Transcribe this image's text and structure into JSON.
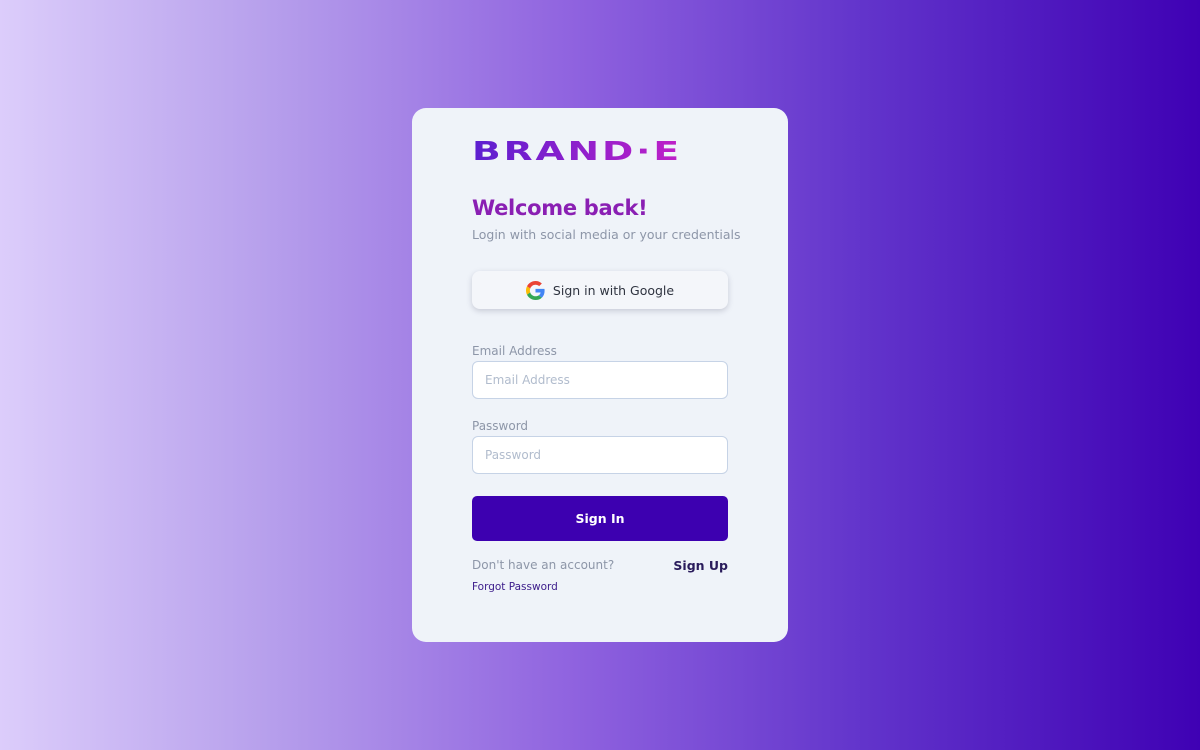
{
  "brand": {
    "name": "BRAND·E",
    "gradient_start": "#5b1fd0",
    "gradient_end": "#c020c8"
  },
  "login": {
    "title": "Welcome back!",
    "subtitle": "Login with social media or your credentials",
    "google_button_label": "Sign in with Google",
    "google_icon": "google-icon",
    "email": {
      "label": "Email Address",
      "placeholder": "Email Address",
      "value": ""
    },
    "password": {
      "label": "Password",
      "placeholder": "Password",
      "value": ""
    },
    "submit_label": "Sign In",
    "no_account_text": "Don't have an account?",
    "signup_label": "Sign Up",
    "forgot_label": "Forgot Password"
  },
  "colors": {
    "primary": "#3d00b0",
    "title": "#8a1fb3",
    "card_bg": "#eff3f9",
    "muted_text": "#8d96a8"
  }
}
